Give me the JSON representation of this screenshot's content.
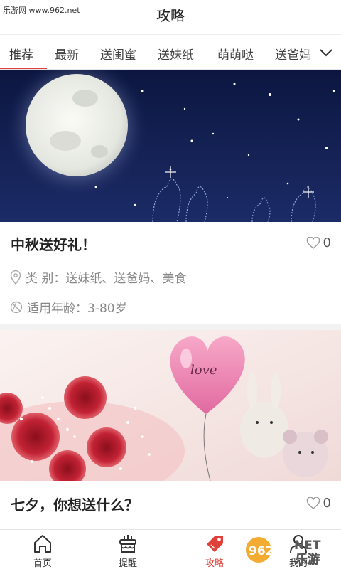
{
  "watermark": {
    "site": "乐游网 www.962.net"
  },
  "header": {
    "title": "攻略"
  },
  "tabs": [
    {
      "label": "推荐",
      "active": true
    },
    {
      "label": "最新",
      "active": false
    },
    {
      "label": "送闺蜜",
      "active": false
    },
    {
      "label": "送妹纸",
      "active": false
    },
    {
      "label": "萌萌哒",
      "active": false
    },
    {
      "label": "送爸妈",
      "active": false
    }
  ],
  "tabs_more_icon": "chevron-down-icon",
  "cards": [
    {
      "banner": "moon-night-scene",
      "title": "中秋送好礼！",
      "likes": "0",
      "category": "类 别：送妹纸、送爸妈、美食",
      "age": "适用年龄：3-80岁"
    },
    {
      "banner": "roses-heart-balloon-scene",
      "title": "七夕，你想送什么？",
      "likes": "0",
      "balloon_text": "love"
    }
  ],
  "bottom_nav": [
    {
      "label": "首页",
      "icon": "home-icon",
      "active": false
    },
    {
      "label": "提醒",
      "icon": "cake-icon",
      "active": false
    },
    {
      "label": "攻略",
      "icon": "tag-icon",
      "active": true
    },
    {
      "label": "我的",
      "icon": "user-icon",
      "active": false
    }
  ],
  "logo_watermark": {
    "text1": "962",
    "text2": "NET",
    "text3": "乐游"
  },
  "colors": {
    "accent": "#e0403a",
    "night_sky": "#0f1a44",
    "text": "#222222",
    "muted": "#888888"
  }
}
